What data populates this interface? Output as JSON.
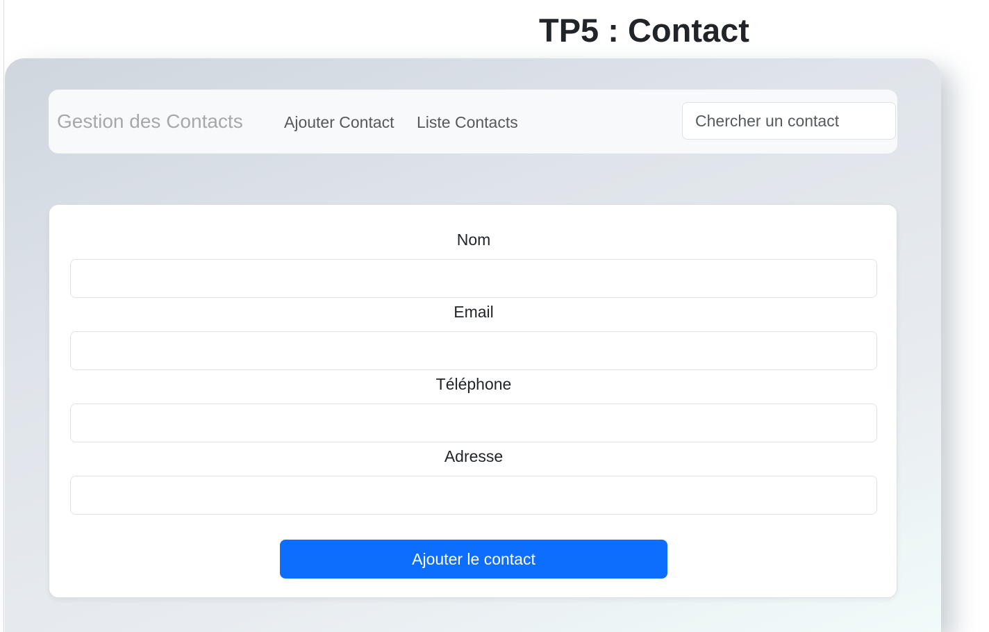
{
  "page": {
    "title": "TP5 : Contact"
  },
  "navbar": {
    "brand": "Gestion des Contacts",
    "links": [
      {
        "label": "Ajouter Contact"
      },
      {
        "label": "Liste Contacts"
      }
    ],
    "search": {
      "placeholder": "Chercher un contact",
      "value": ""
    }
  },
  "form": {
    "fields": [
      {
        "label": "Nom",
        "value": ""
      },
      {
        "label": "Email",
        "value": ""
      },
      {
        "label": "Téléphone",
        "value": ""
      },
      {
        "label": "Adresse",
        "value": ""
      }
    ],
    "submit_label": "Ajouter le contact"
  },
  "colors": {
    "primary": "#0d6efd",
    "navbar_bg": "#f8f9fa",
    "brand_text": "#a6a8ab"
  }
}
